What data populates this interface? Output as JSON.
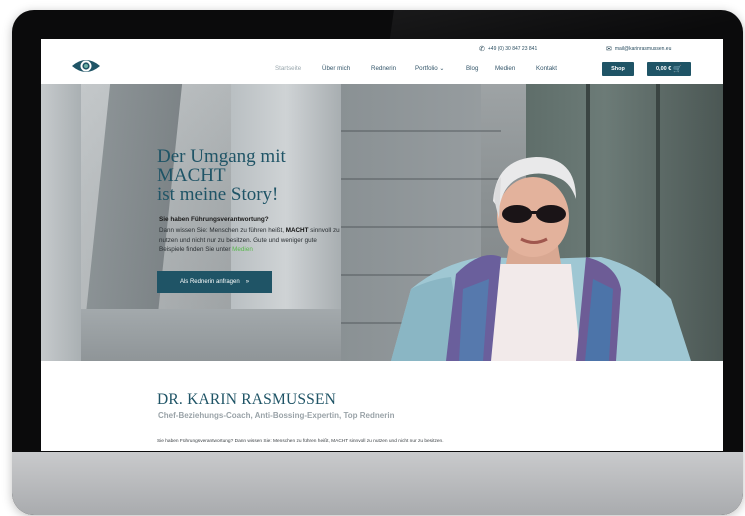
{
  "topbar": {
    "phone_icon": "phone-icon",
    "phone": "+49 (0) 30 847 23 841",
    "mail_icon": "envelope-icon",
    "email": "mail@karinrasmussen.eu"
  },
  "nav": {
    "items": [
      "Startseite",
      "Über mich",
      "Rednerin",
      "Portfolio ⌄",
      "Blog",
      "Medien",
      "Kontakt"
    ],
    "active_index": 0
  },
  "header_buttons": {
    "shop_label": "Shop",
    "cart_label": "0,00 €",
    "cart_icon": "cart-icon"
  },
  "hero": {
    "headline_line1": "Der Umgang mit",
    "headline_line2": "MACHT",
    "headline_line3": "ist meine Story!",
    "subheading": "Sie haben Führungsverantwortung?",
    "body_part1": "Dann wissen Sie: Menschen zu führen heißt, ",
    "body_bold": "MACHT",
    "body_part2": " sinnvoll zu nutzen und nicht nur zu besitzen. Gute und weniger gute Beispiele finden Sie unter ",
    "body_link": "Medien",
    "button_label": "Als Rednerin anfragen",
    "button_icon": "chevrons-right-icon"
  },
  "intro": {
    "name": "DR. KARIN RASMUSSEN",
    "tagline": "Chef-Beziehungs-Coach, Anti-Bossing-Expertin, Top Rednerin",
    "text": "Sie haben Führungsverantwortung? Dann wissen Sie: Menschen zu führen heißt, MACHT sinnvoll zu nutzen und nicht nur zu besitzen."
  },
  "colors": {
    "brand": "#1f5466",
    "accent_green": "#57b84a",
    "tagline_gray": "#9aa3a8"
  }
}
